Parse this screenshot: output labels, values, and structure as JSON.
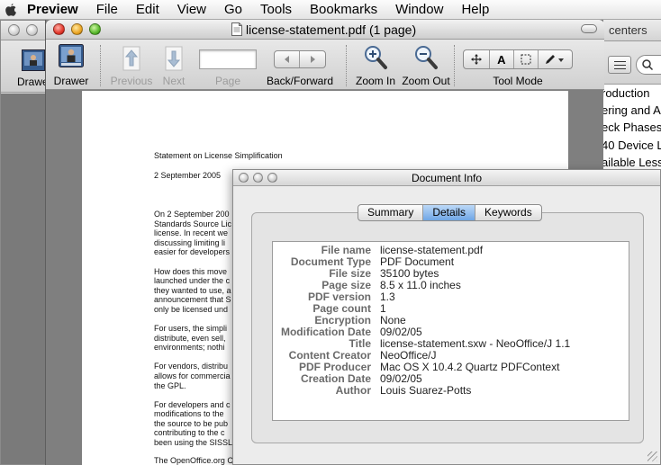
{
  "menubar": {
    "items": [
      "Preview",
      "File",
      "Edit",
      "View",
      "Go",
      "Tools",
      "Bookmarks",
      "Window",
      "Help"
    ]
  },
  "far_window": {
    "drawer_label": "Drawer"
  },
  "right_window": {
    "title": "centers",
    "items": [
      "roduction",
      "ering and A",
      "eck Phases",
      "40 Device L",
      "ailable Less"
    ]
  },
  "main_window": {
    "title": "license-statement.pdf (1 page)",
    "toolbar": {
      "drawer": "Drawer",
      "previous": "Previous",
      "next": "Next",
      "page": "Page",
      "back_forward": "Back/Forward",
      "zoom_in": "Zoom In",
      "zoom_out": "Zoom Out",
      "tool_mode": "Tool Mode",
      "text_tool": "A"
    },
    "pdf_text": [
      "Statement on License Simplification",
      "2 September 2005",
      "On 2 September 200",
      "Standards Source Lic",
      "license.  In recent we",
      "discussing limiting li",
      "easier for developers",
      "How does this move",
      "launched under the c",
      "they wanted to use, a",
      "announcement that S",
      "only be licensed und",
      "For users, the simpli",
      "distribute, even sell,",
      "environments; nothi",
      "For vendors, distribu",
      "allows for commercia",
      "the GPL.",
      "For developers and c",
      "modifications to the",
      "the source to be pub",
      "contributing to the c",
      "been using the SISSL",
      "The OpenOffice.org Community Council"
    ]
  },
  "doc_info": {
    "title": "Document Info",
    "tabs": [
      "Summary",
      "Details",
      "Keywords"
    ],
    "active_tab": "Details",
    "fields": [
      {
        "label": "File name",
        "value": "license-statement.pdf"
      },
      {
        "label": "Document Type",
        "value": "PDF Document"
      },
      {
        "label": "File size",
        "value": "35100 bytes"
      },
      {
        "label": "Page size",
        "value": "8.5 x 11.0 inches"
      },
      {
        "label": "PDF version",
        "value": "1.3"
      },
      {
        "label": "Page count",
        "value": "1"
      },
      {
        "label": "Encryption",
        "value": "None"
      },
      {
        "label": "Modification Date",
        "value": "09/02/05"
      },
      {
        "label": "Title",
        "value": "license-statement.sxw - NeoOffice/J 1.1"
      },
      {
        "label": "Content Creator",
        "value": "NeoOffice/J"
      },
      {
        "label": "PDF Producer",
        "value": "Mac OS X 10.4.2 Quartz PDFContext"
      },
      {
        "label": "Creation Date",
        "value": "09/02/05"
      },
      {
        "label": "Author",
        "value": "Louis Suarez-Potts"
      }
    ]
  }
}
